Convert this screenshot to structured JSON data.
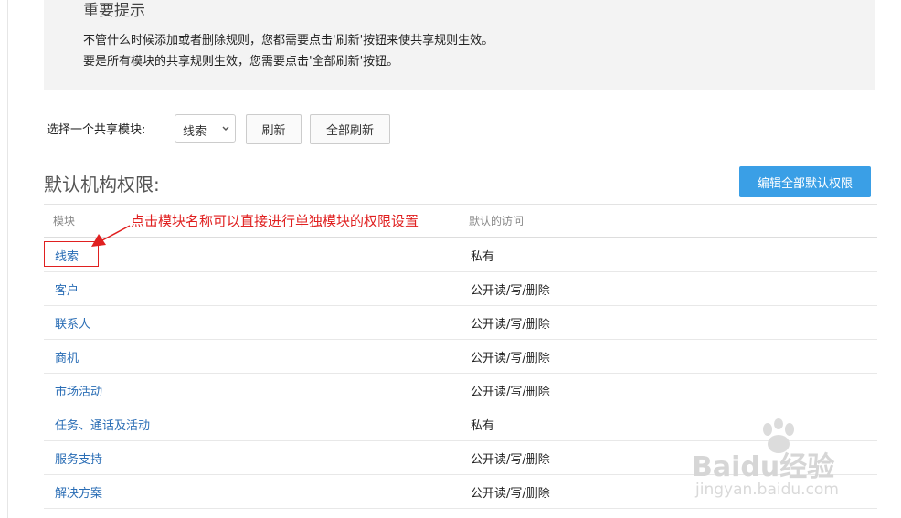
{
  "notice": {
    "title": "重要提示",
    "line1": "不管什么时候添加或者删除规则，您都需要点击'刷新'按钮来使共享规则生效。",
    "line2": "要是所有模块的共享规则生效，您需要点击'全部刷新'按钮。"
  },
  "toolbar": {
    "select_label": "选择一个共享模块:",
    "selected_module": "线索",
    "refresh_label": "刷新",
    "refresh_all_label": "全部刷新"
  },
  "section": {
    "title": "默认机构权限:",
    "edit_all_label": "编辑全部默认权限"
  },
  "table": {
    "col_module": "模块",
    "col_access": "默认的访问",
    "rows": [
      {
        "module": "线索",
        "access": "私有"
      },
      {
        "module": "客户",
        "access": "公开读/写/删除"
      },
      {
        "module": "联系人",
        "access": "公开读/写/删除"
      },
      {
        "module": "商机",
        "access": "公开读/写/删除"
      },
      {
        "module": "市场活动",
        "access": "公开读/写/删除"
      },
      {
        "module": "任务、通话及活动",
        "access": "私有"
      },
      {
        "module": "服务支持",
        "access": "公开读/写/删除"
      },
      {
        "module": "解决方案",
        "access": "公开读/写/删除"
      }
    ]
  },
  "annotation": {
    "text": "点击模块名称可以直接进行单独模块的权限设置",
    "color": "#e02020"
  },
  "watermark": {
    "text": "Baidu经验",
    "url": "jingyan.baidu.com"
  },
  "colors": {
    "primary_button": "#3a9fe6",
    "link": "#2a6db5",
    "notice_bg": "#f3f3f3"
  }
}
